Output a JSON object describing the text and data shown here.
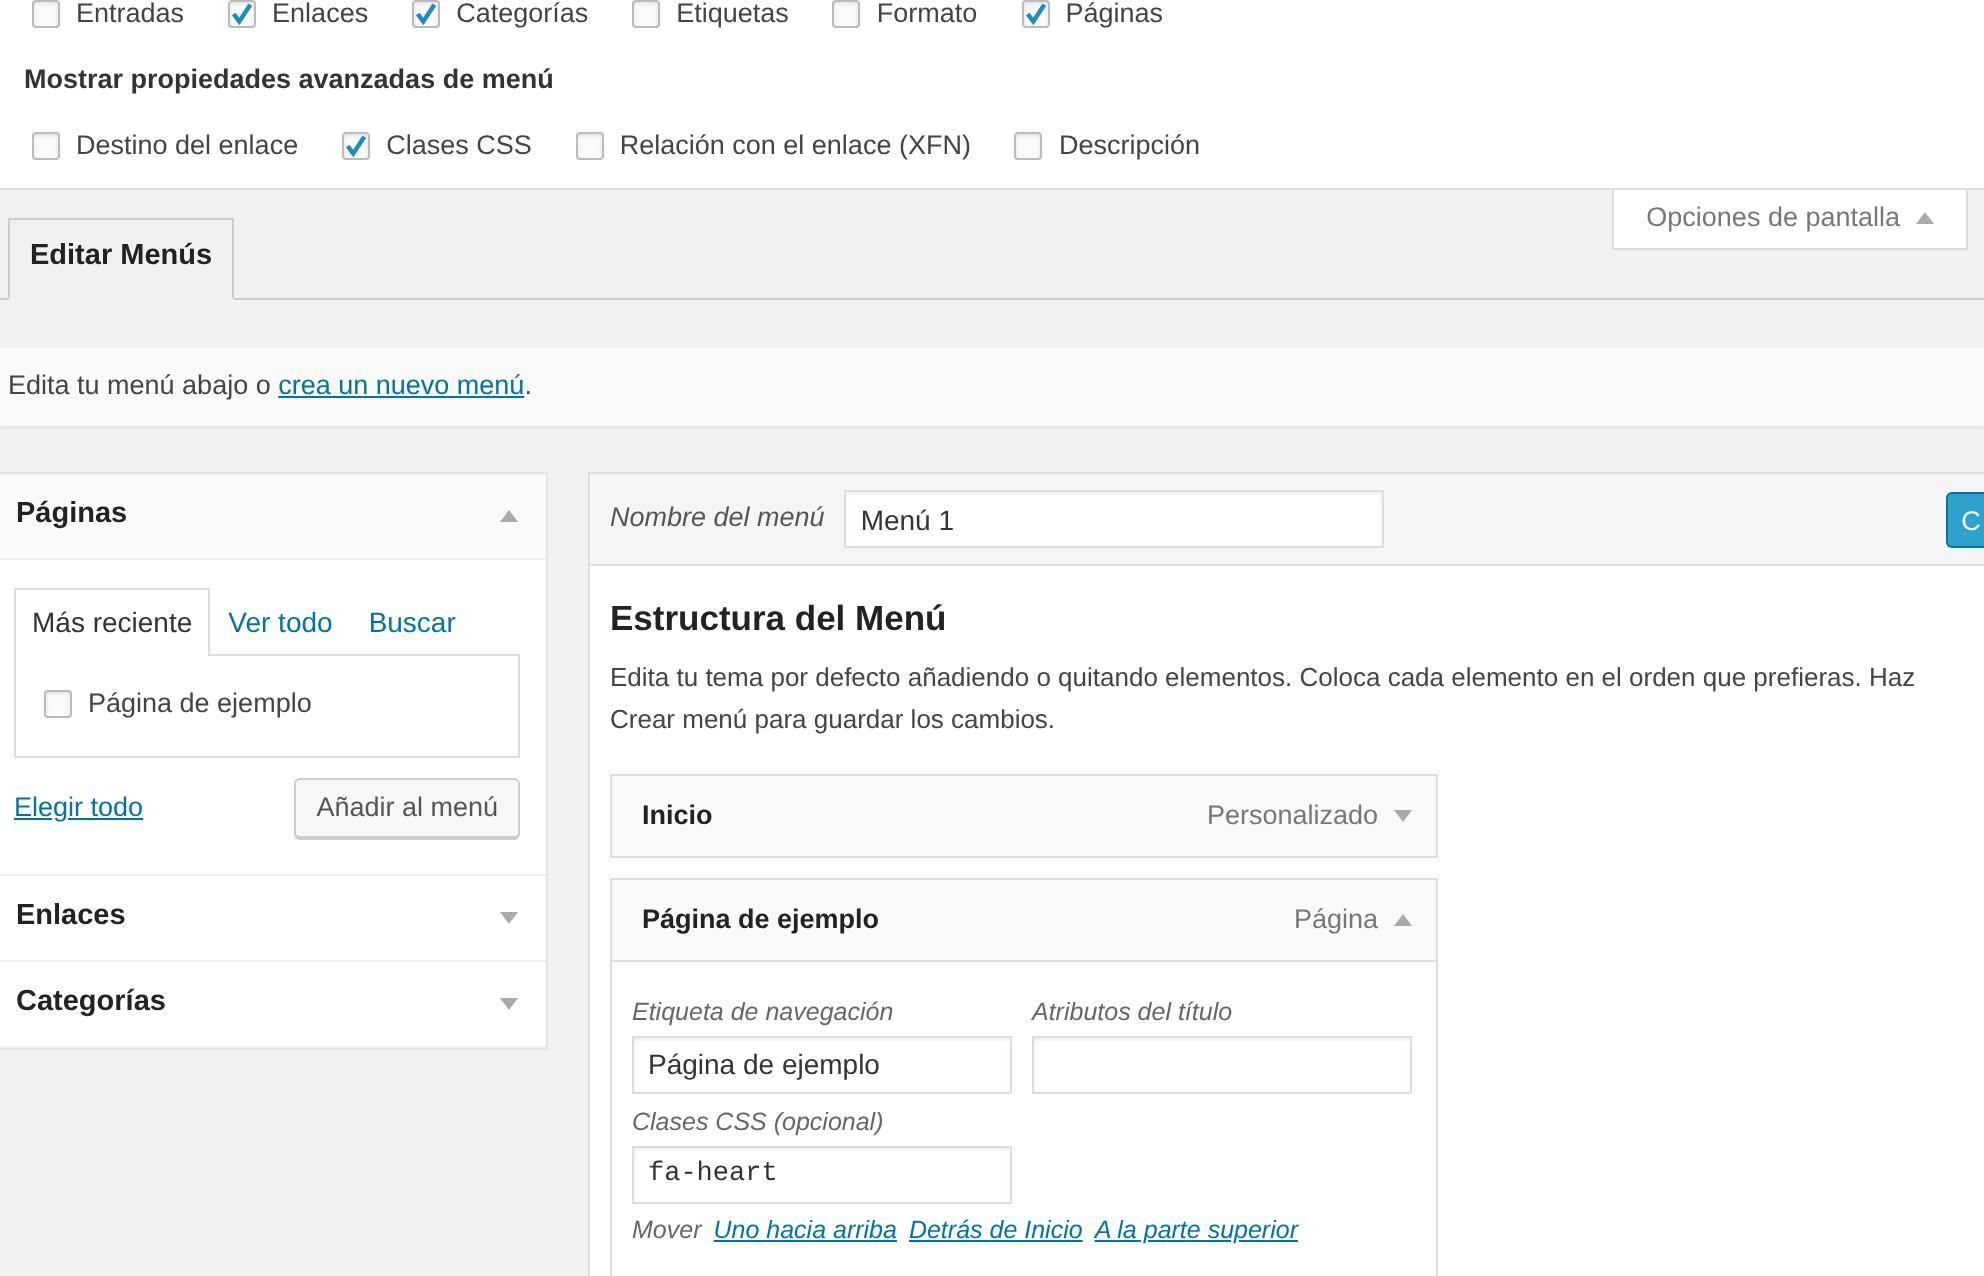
{
  "screen_options": {
    "boxes": [
      {
        "label": "Entradas",
        "checked": false
      },
      {
        "label": "Enlaces",
        "checked": true
      },
      {
        "label": "Categorías",
        "checked": true
      },
      {
        "label": "Etiquetas",
        "checked": false
      },
      {
        "label": "Formato",
        "checked": false
      },
      {
        "label": "Páginas",
        "checked": true
      }
    ],
    "advanced_heading": "Mostrar propiedades avanzadas de menú",
    "advanced": [
      {
        "label": "Destino del enlace",
        "checked": false
      },
      {
        "label": "Clases CSS",
        "checked": true
      },
      {
        "label": "Relación con el enlace (XFN)",
        "checked": false
      },
      {
        "label": "Descripción",
        "checked": false
      }
    ],
    "toggle": "Opciones de pantalla",
    "expanded": true
  },
  "tabs": [
    {
      "label": "Editar Menús",
      "selected": true
    }
  ],
  "notice": {
    "text": "Edita tu menú abajo o ",
    "link": "crea un nuevo menú",
    "after": "."
  },
  "sidebar": {
    "sections": [
      {
        "title": "Páginas",
        "expanded": true,
        "tabs": [
          {
            "label": "Más reciente",
            "selected": true
          },
          {
            "label": "Ver todo",
            "selected": false
          },
          {
            "label": "Buscar",
            "selected": false
          }
        ],
        "items": [
          {
            "label": "Página de ejemplo",
            "checked": false
          }
        ],
        "select_all": "Elegir todo",
        "add_button": "Añadir al menú"
      },
      {
        "title": "Enlaces",
        "expanded": false
      },
      {
        "title": "Categorías",
        "expanded": false
      }
    ]
  },
  "menu_editor": {
    "name_label": "Nombre del menú",
    "name_value": "Menú 1",
    "save_button": "C",
    "heading": "Estructura del Menú",
    "description": [
      "Edita tu tema por defecto añadiendo o quitando elementos. Coloca cada elemento en el orden que prefieras. Haz",
      "Crear menú para guardar los cambios."
    ],
    "items": [
      {
        "title": "Inicio",
        "type": "Personalizado",
        "expanded": false
      },
      {
        "title": "Página de ejemplo",
        "type": "Página",
        "expanded": true,
        "nav_label": "Etiqueta de navegación",
        "nav_value": "Página de ejemplo",
        "title_attr_label": "Atributos del título",
        "css_label": "Clases CSS (opcional)",
        "css_value": "fa-heart",
        "move_label": "Mover",
        "move_links": [
          "Uno hacia arriba",
          "Detrás de Inicio",
          "A la parte superior"
        ]
      }
    ]
  }
}
